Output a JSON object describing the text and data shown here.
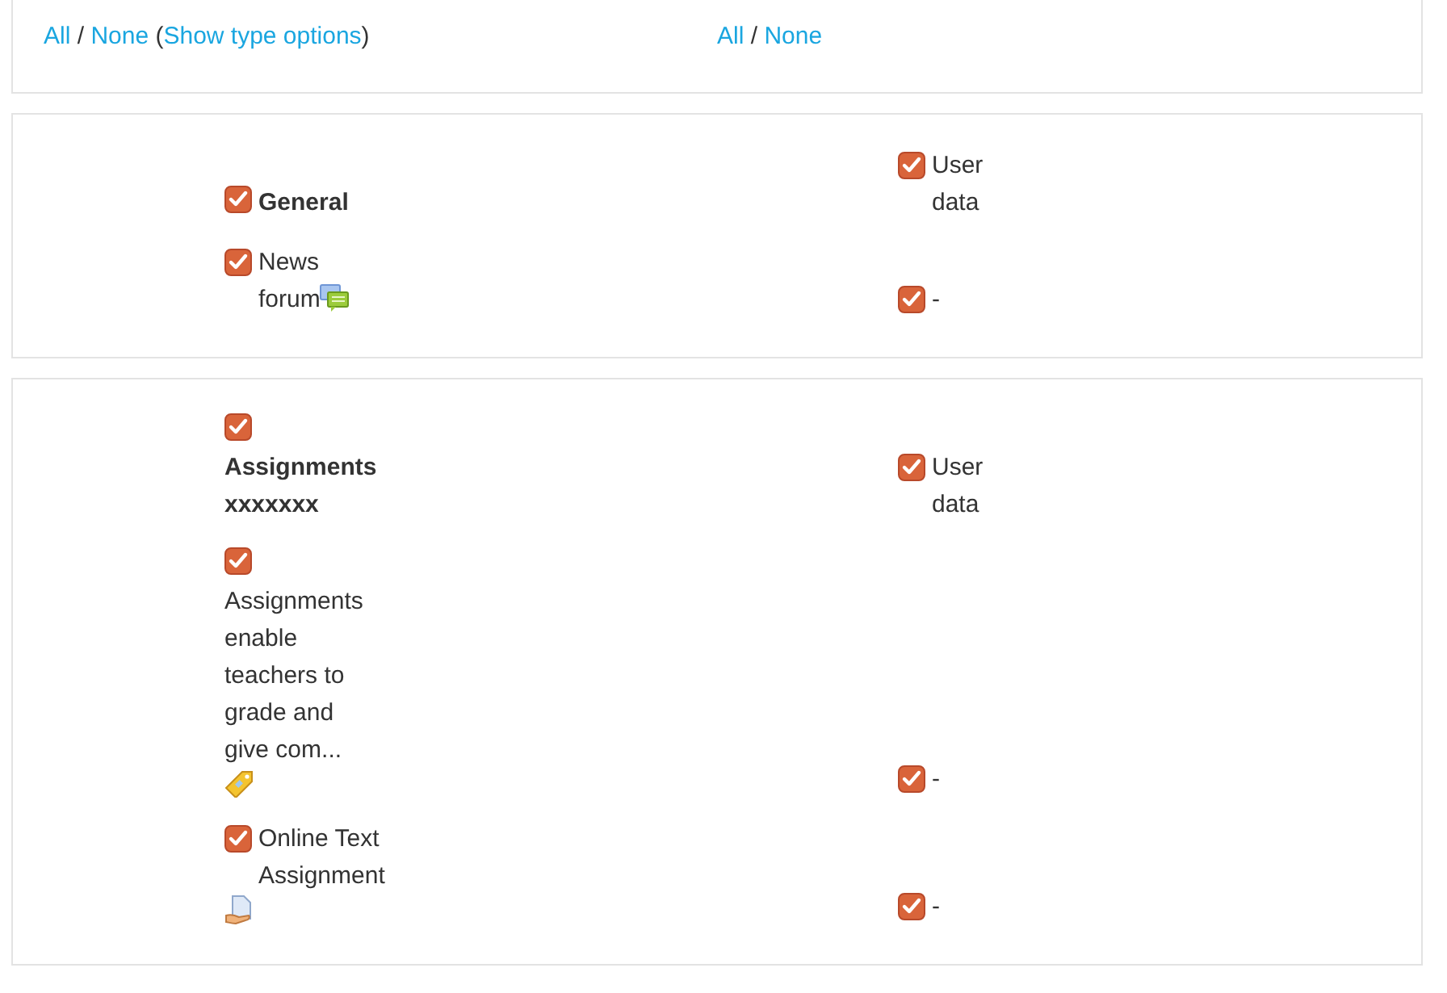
{
  "select_bar": {
    "columns": [
      {
        "parts": [
          {
            "kind": "link",
            "text": "All"
          },
          {
            "kind": "text",
            "text": " / "
          },
          {
            "kind": "link",
            "text": "None"
          },
          {
            "kind": "text",
            "text": " ("
          },
          {
            "kind": "link",
            "text": "Show type options"
          },
          {
            "kind": "text",
            "text": ")"
          }
        ]
      },
      {
        "parts": [
          {
            "kind": "link",
            "text": "All"
          },
          {
            "kind": "text",
            "text": " / "
          },
          {
            "kind": "link",
            "text": "None"
          }
        ]
      }
    ]
  },
  "sections": [
    {
      "rows": [
        {
          "item": {
            "kind": "section",
            "checked": true,
            "label": "General"
          },
          "option": {
            "checked": true,
            "label": "User data"
          }
        },
        {
          "item": {
            "kind": "forum",
            "checked": true,
            "label": "News forum"
          },
          "option": {
            "checked": true,
            "label": "-"
          }
        }
      ]
    },
    {
      "rows": [
        {
          "item": {
            "kind": "section",
            "checked": true,
            "label": "Assignments xxxxxxx"
          },
          "option": {
            "checked": true,
            "label": "User data"
          }
        },
        {
          "item": {
            "kind": "assignment",
            "checked": true,
            "label": "Assignments enable teachers to grade and give com..."
          },
          "option": {
            "checked": true,
            "label": "-"
          }
        },
        {
          "item": {
            "kind": "online_text",
            "checked": true,
            "label": "Online Text Assignment"
          },
          "option": {
            "checked": true,
            "label": "-"
          }
        }
      ]
    }
  ]
}
